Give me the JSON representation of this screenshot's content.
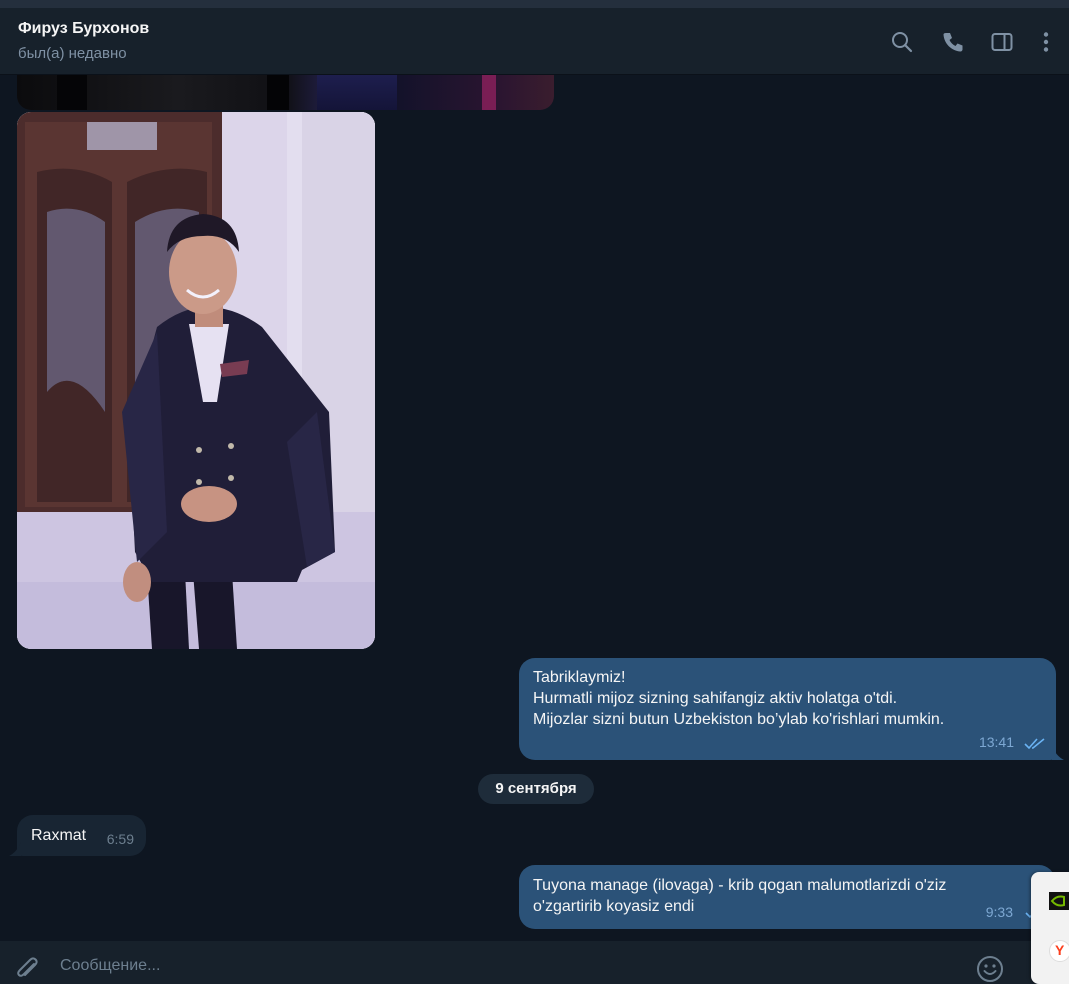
{
  "header": {
    "contact_name": "Фируз Бурхонов",
    "status": "был(а) недавно",
    "icons": [
      "search-icon",
      "phone-icon",
      "sidebar-toggle-icon",
      "more-vertical-icon"
    ]
  },
  "messages": [
    {
      "direction": "out",
      "lines": [
        "Tabriklaymiz!",
        "Hurmatli mijoz sizning sahifangiz aktiv holatga o'tdi.",
        "Mijozlar sizni butun Uzbekiston bo’ylab ko'rishlari mumkin."
      ],
      "time": "13:41",
      "read": true
    },
    {
      "direction": "in",
      "lines": [
        "Raxmat"
      ],
      "time": "6:59"
    },
    {
      "direction": "out",
      "lines": [
        "Tuyona manage (ilovaga) - krib qogan malumotlarizdi o'ziz",
        "o'zgartirib koyasiz endi"
      ],
      "time": "9:33",
      "read": false
    }
  ],
  "date_separator": "9 сентября",
  "composer": {
    "placeholder": "Сообщение...",
    "value": ""
  },
  "colors": {
    "background": "#0e1621",
    "header": "#17212b",
    "outgoing_bubble": "#2b5278",
    "incoming_bubble": "#182533",
    "accent": "#6ab3f3"
  }
}
